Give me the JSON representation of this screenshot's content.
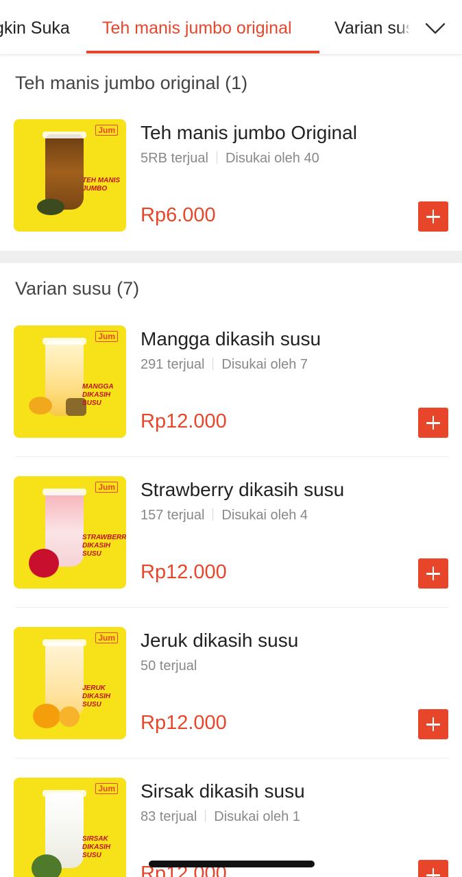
{
  "tabs": [
    {
      "label": "gkin Suka",
      "active": false
    },
    {
      "label": "Teh manis jumbo original",
      "active": true
    },
    {
      "label": "Varian susu",
      "active": false
    }
  ],
  "colors": {
    "accent": "#e8462b",
    "thumb_bg": "#f7e21a"
  },
  "icons": {
    "tabs_expand": "chevron-down-icon",
    "add": "plus-icon"
  },
  "sections": [
    {
      "title": "Teh manis jumbo original (1)",
      "items": [
        {
          "name": "Teh manis jumbo Original",
          "sold": "5RB terjual",
          "likes": "Disukai oleh 40",
          "price": "Rp6.000",
          "thumb_text": "TEH MANIS JUMBO",
          "brand_mark": "Jum",
          "cup_brand": "Jumbo"
        }
      ]
    },
    {
      "title": "Varian susu (7)",
      "items": [
        {
          "name": "Mangga dikasih susu",
          "sold": "291 terjual",
          "likes": "Disukai oleh 7",
          "price": "Rp12.000",
          "thumb_text": "MANGGA DIKASIH SUSU",
          "brand_mark": "Jum",
          "cup_brand": "Jumbo"
        },
        {
          "name": "Strawberry dikasih susu",
          "sold": "157 terjual",
          "likes": "Disukai oleh 4",
          "price": "Rp12.000",
          "thumb_text": "STRAWBERRY DIKASIH SUSU",
          "brand_mark": "Jum",
          "cup_brand": "Jumbo"
        },
        {
          "name": "Jeruk dikasih susu",
          "sold": "50 terjual",
          "likes": "",
          "price": "Rp12.000",
          "thumb_text": "JERUK DIKASIH SUSU",
          "brand_mark": "Jum",
          "cup_brand": "Jumbo"
        },
        {
          "name": "Sirsak dikasih susu",
          "sold": "83 terjual",
          "likes": "Disukai oleh 1",
          "price": "Rp12.000",
          "thumb_text": "SIRSAK DIKASIH SUSU",
          "brand_mark": "Jum",
          "cup_brand": "Jumbo"
        }
      ]
    }
  ]
}
